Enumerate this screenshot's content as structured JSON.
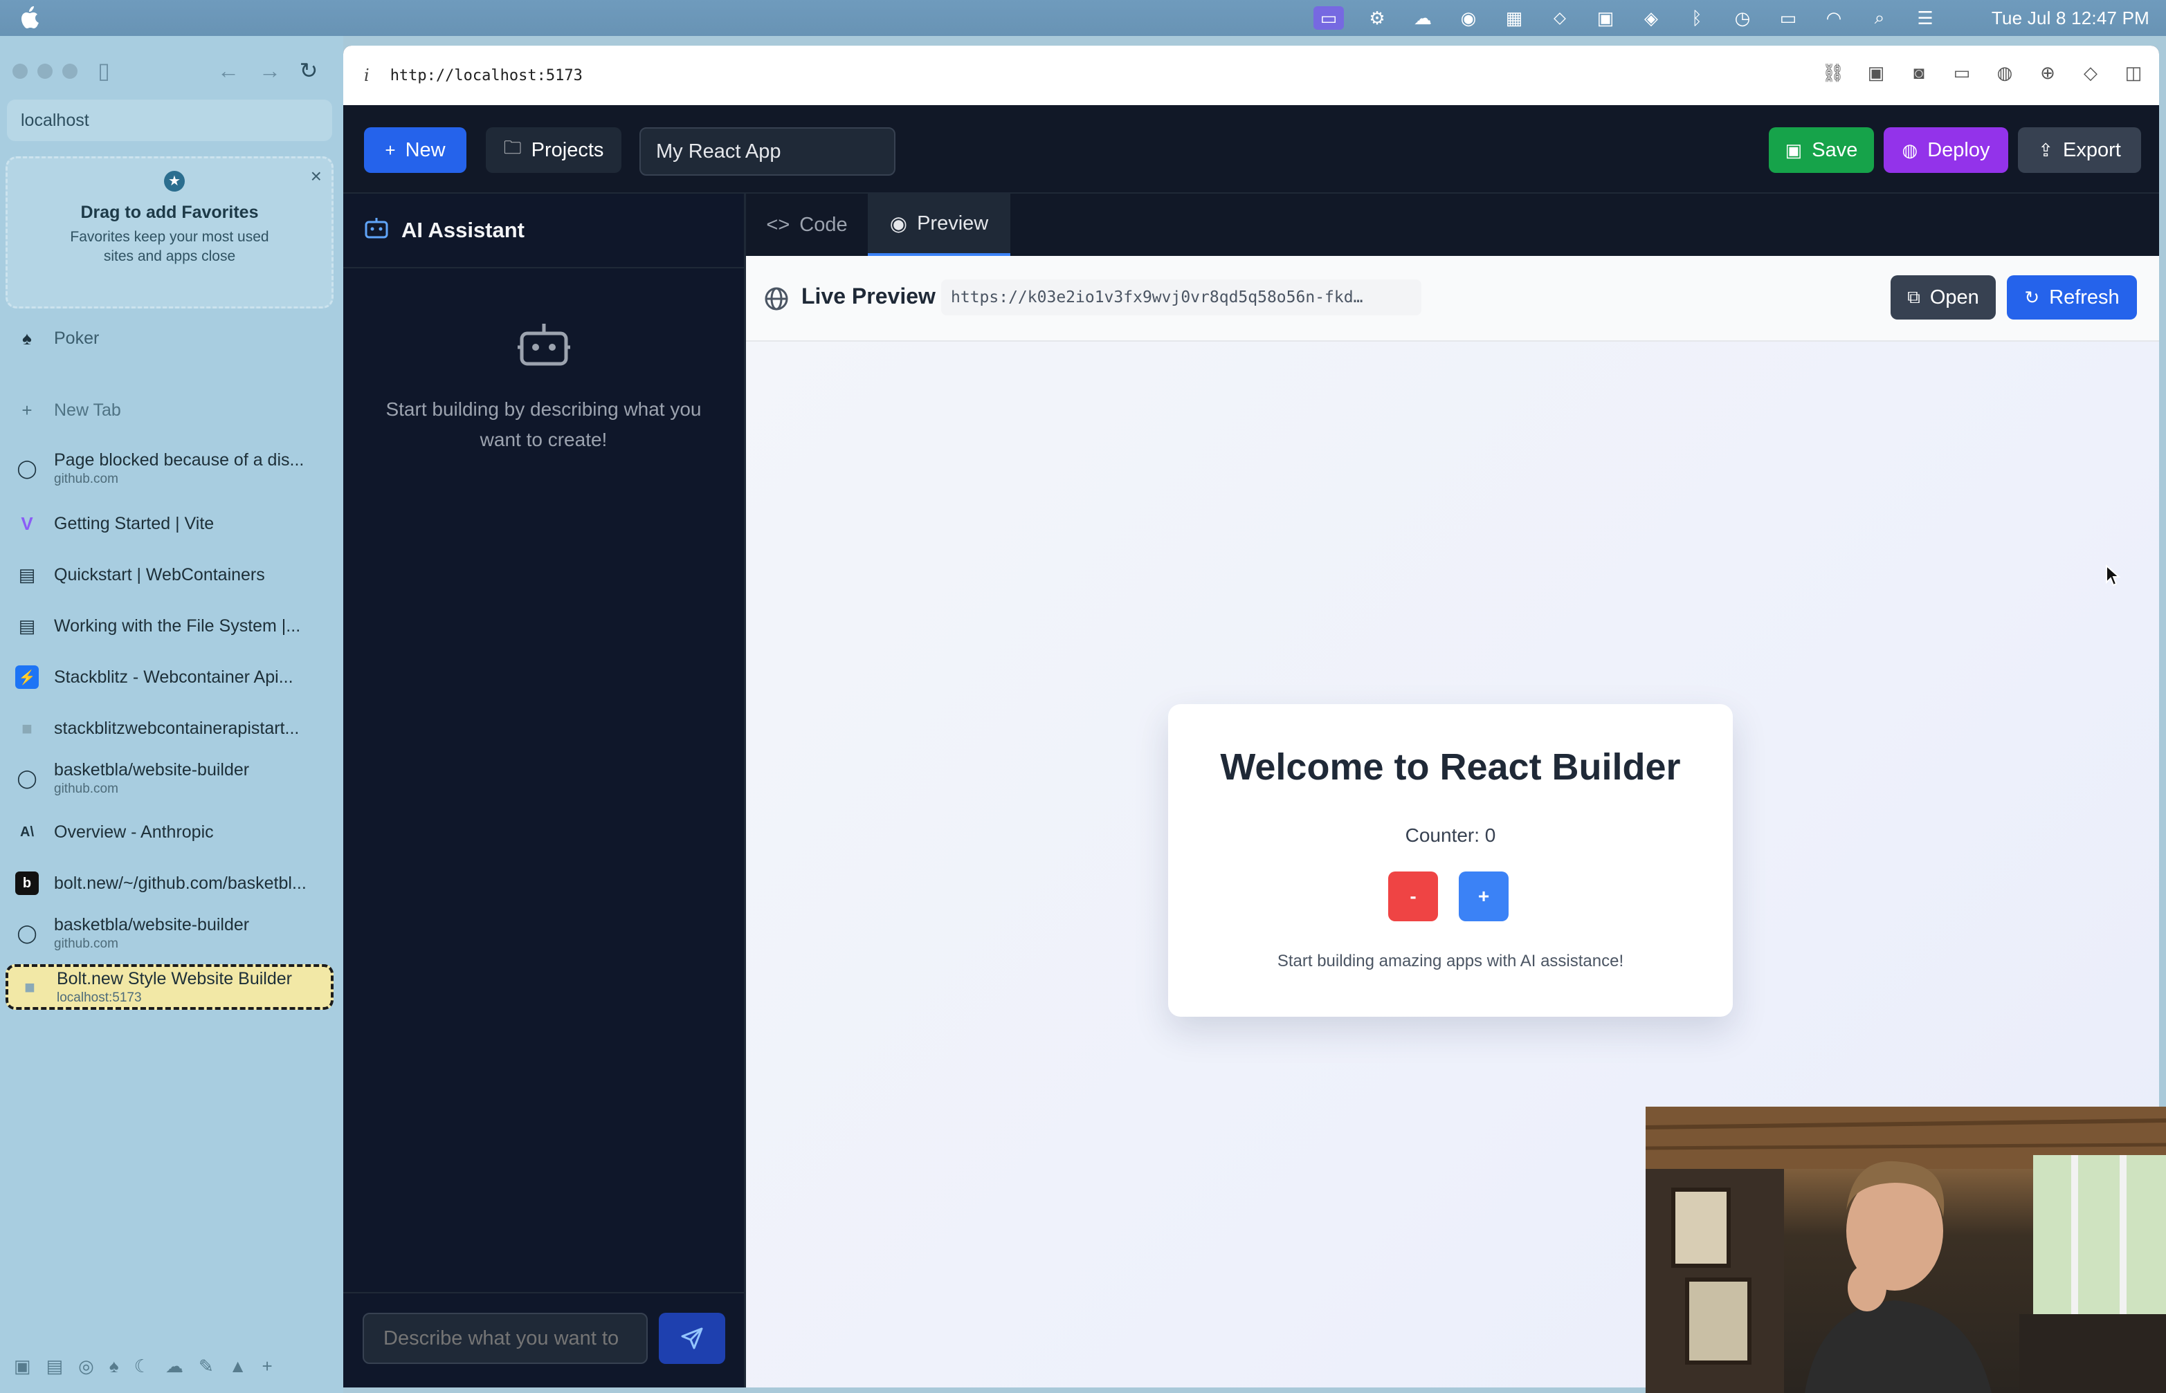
{
  "menubar": {
    "clock": "Tue Jul 8  12:47 PM"
  },
  "sidebar": {
    "url_text": "localhost",
    "favorites": {
      "title": "Drag to add Favorites",
      "subtitle": "Favorites keep your most used sites and apps close"
    },
    "pinned": [
      {
        "label": "Poker",
        "icon": "spade-icon"
      }
    ],
    "new_tab_label": "New Tab",
    "tabs": [
      {
        "label": "Page blocked because of a dis...",
        "sub": "github.com",
        "icon": "github-icon"
      },
      {
        "label": "Getting Started | Vite",
        "sub": "",
        "icon": "vite-icon"
      },
      {
        "label": "Quickstart | WebContainers",
        "sub": "",
        "icon": "terminal-icon"
      },
      {
        "label": "Working with the File System |...",
        "sub": "",
        "icon": "terminal-icon"
      },
      {
        "label": "Stackblitz - Webcontainer Api...",
        "sub": "",
        "icon": "stackblitz-icon"
      },
      {
        "label": "stackblitzwebcontainerapistart...",
        "sub": "",
        "icon": "page-icon"
      },
      {
        "label": "basketbla/website-builder",
        "sub": "github.com",
        "icon": "github-icon"
      },
      {
        "label": "Overview - Anthropic",
        "sub": "",
        "icon": "anthropic-icon"
      },
      {
        "label": "bolt.new/~/github.com/basketbl...",
        "sub": "",
        "icon": "bolt-icon"
      },
      {
        "label": "basketbla/website-builder",
        "sub": "github.com",
        "icon": "github-icon"
      },
      {
        "label": "Bolt.new Style Website Builder",
        "sub": "localhost:5173",
        "icon": "page-icon",
        "active": true
      }
    ]
  },
  "browser": {
    "info_glyph": "i",
    "url": "http://localhost:5173"
  },
  "header": {
    "new_label": "New",
    "projects_label": "Projects",
    "project_name": "My React App",
    "save_label": "Save",
    "deploy_label": "Deploy",
    "export_label": "Export",
    "colors": {
      "save": "#16a34a",
      "deploy": "#9333ea",
      "new": "#2563eb",
      "export": "#374151"
    }
  },
  "ai": {
    "title": "AI Assistant",
    "empty_text": "Start building by describing what you want to create!",
    "input_placeholder": "Describe what you want to"
  },
  "tabs": {
    "code_label": "Code",
    "preview_label": "Preview"
  },
  "preview": {
    "title": "Live Preview",
    "url": "https://k03e2io1v3fx9wvj0vr8qd5q58o56n-fkd…",
    "open_label": "Open",
    "refresh_label": "Refresh"
  },
  "app": {
    "title": "Welcome to React Builder",
    "counter_text": "Counter: 0",
    "minus_label": "-",
    "plus_label": "+",
    "note": "Start building amazing apps with AI assistance!"
  }
}
